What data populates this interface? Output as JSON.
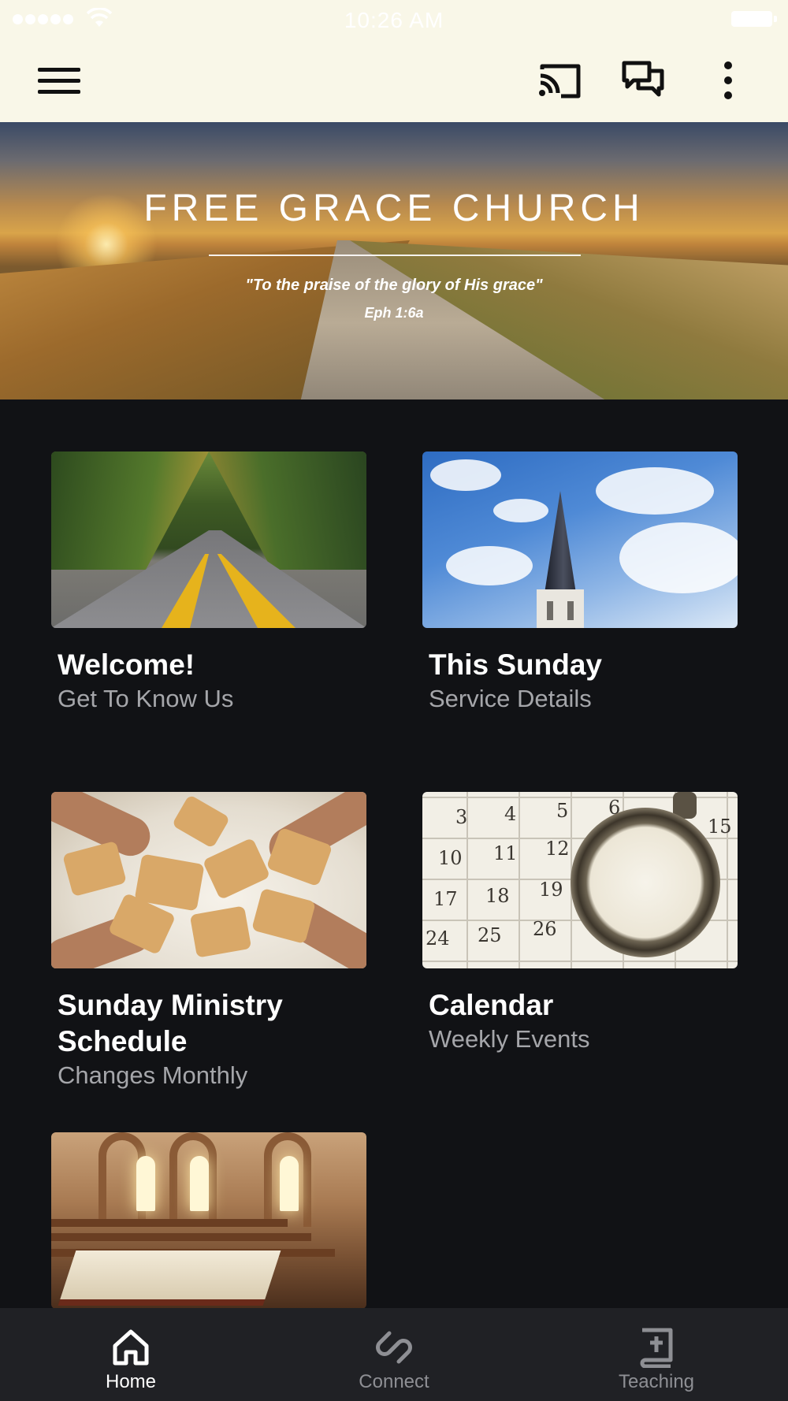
{
  "status_bar": {
    "time": "10:26 AM"
  },
  "app_bar": {
    "menu_icon": "hamburger-menu-icon",
    "cast_icon": "cast-icon",
    "chat_icon": "chat-bubbles-icon",
    "more_icon": "more-vertical-icon",
    "background_color": "#f9f7e8"
  },
  "hero": {
    "title": "FREE GRACE CHURCH",
    "quote": "\"To the praise of the glory of His grace\"",
    "reference": "Eph 1:6a"
  },
  "tiles": [
    {
      "title": "Welcome!",
      "subtitle": "Get To Know Us"
    },
    {
      "title": "This Sunday",
      "subtitle": "Service Details"
    },
    {
      "title": "Sunday Ministry Schedule",
      "subtitle": "Changes Monthly"
    },
    {
      "title": "Calendar",
      "subtitle": "Weekly Events"
    },
    {
      "title": "",
      "subtitle": ""
    }
  ],
  "calendar_numbers": [
    "3",
    "4",
    "5",
    "6",
    "10",
    "11",
    "12",
    "17",
    "18",
    "19",
    "24",
    "25",
    "26",
    "15"
  ],
  "bottom_nav": {
    "items": [
      {
        "label": "Home",
        "icon": "home-icon",
        "active": true
      },
      {
        "label": "Connect",
        "icon": "connect-icon",
        "active": false
      },
      {
        "label": "Teaching",
        "icon": "bible-icon",
        "active": false
      }
    ],
    "active_color": "#ffffff",
    "inactive_color": "#8e8f94",
    "background_color": "#202125"
  },
  "page_background": "#111215"
}
